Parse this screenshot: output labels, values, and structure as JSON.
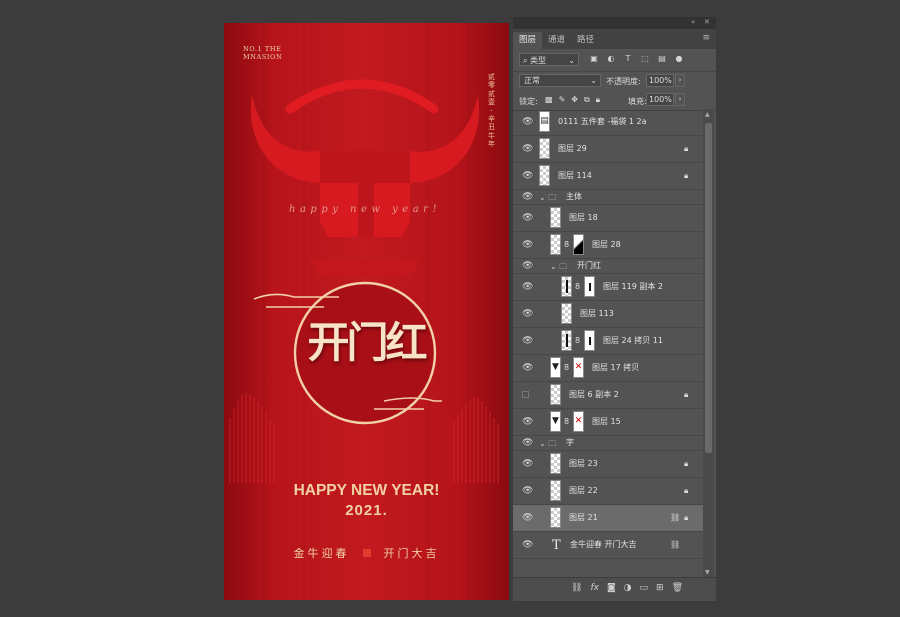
{
  "poster": {
    "brand_line1": "NO.1 THE",
    "brand_line2": "MNASION",
    "vertical_text": "贰零贰壹 · 辛丑牛年",
    "script_text": "happy new year!",
    "title": "开门红",
    "greeting": "HAPPY NEW YEAR!",
    "year": "2021.",
    "footer_left": "金牛迎春",
    "footer_right": "开门大吉",
    "colors": {
      "bg": "#b8141b",
      "gold": "#f1d1a2",
      "horn": "#d71920"
    }
  },
  "panel": {
    "tabs": [
      {
        "label": "图层",
        "active": true
      },
      {
        "label": "通道",
        "active": false
      },
      {
        "label": "路径",
        "active": false
      }
    ],
    "filter_kind": "类型",
    "blend_mode": "正常",
    "opacity_label": "不透明度:",
    "opacity_value": "100%",
    "lock_label": "锁定:",
    "fill_label": "填充:",
    "fill_value": "100%",
    "layers": [
      {
        "name": "0111 五件套 -福袋 1 2a",
        "visible": true,
        "indent": 0,
        "type": "smart",
        "locked": false
      },
      {
        "name": "图层 29",
        "visible": true,
        "indent": 0,
        "type": "pixel",
        "locked": true
      },
      {
        "name": "图层 114",
        "visible": true,
        "indent": 0,
        "type": "pixel",
        "locked": true
      },
      {
        "name": "主体",
        "visible": true,
        "indent": 0,
        "type": "group"
      },
      {
        "name": "图层 18",
        "visible": true,
        "indent": 1,
        "type": "pixel",
        "locked": false
      },
      {
        "name": "图层 28",
        "visible": true,
        "indent": 1,
        "type": "masked-dark",
        "locked": false
      },
      {
        "name": "开门红",
        "visible": true,
        "indent": 1,
        "type": "group"
      },
      {
        "name": "图层 119 副本 2",
        "visible": true,
        "indent": 2,
        "type": "masked-bar",
        "locked": false
      },
      {
        "name": "图层 113",
        "visible": true,
        "indent": 2,
        "type": "pixel",
        "locked": false
      },
      {
        "name": "图层 24 拷贝 11",
        "visible": true,
        "indent": 2,
        "type": "masked-bar",
        "locked": false
      },
      {
        "name": "图层 17 拷贝",
        "visible": true,
        "indent": 1,
        "type": "masked-x",
        "locked": false
      },
      {
        "name": "图层 6 副本 2",
        "visible": false,
        "indent": 1,
        "type": "pixel",
        "locked": true
      },
      {
        "name": "图层 15",
        "visible": true,
        "indent": 1,
        "type": "masked-x",
        "locked": false
      },
      {
        "name": "字",
        "visible": true,
        "indent": 0,
        "type": "group"
      },
      {
        "name": "图层 23",
        "visible": true,
        "indent": 1,
        "type": "pixel",
        "locked": true
      },
      {
        "name": "图层 22",
        "visible": true,
        "indent": 1,
        "type": "pixel",
        "locked": true
      },
      {
        "name": "图层 21",
        "visible": true,
        "indent": 1,
        "type": "pixel",
        "locked": true,
        "linked": true,
        "selected": true
      },
      {
        "name": "金牛迎春   开门大吉",
        "visible": true,
        "indent": 1,
        "type": "text",
        "locked": false,
        "linked": true
      }
    ]
  }
}
